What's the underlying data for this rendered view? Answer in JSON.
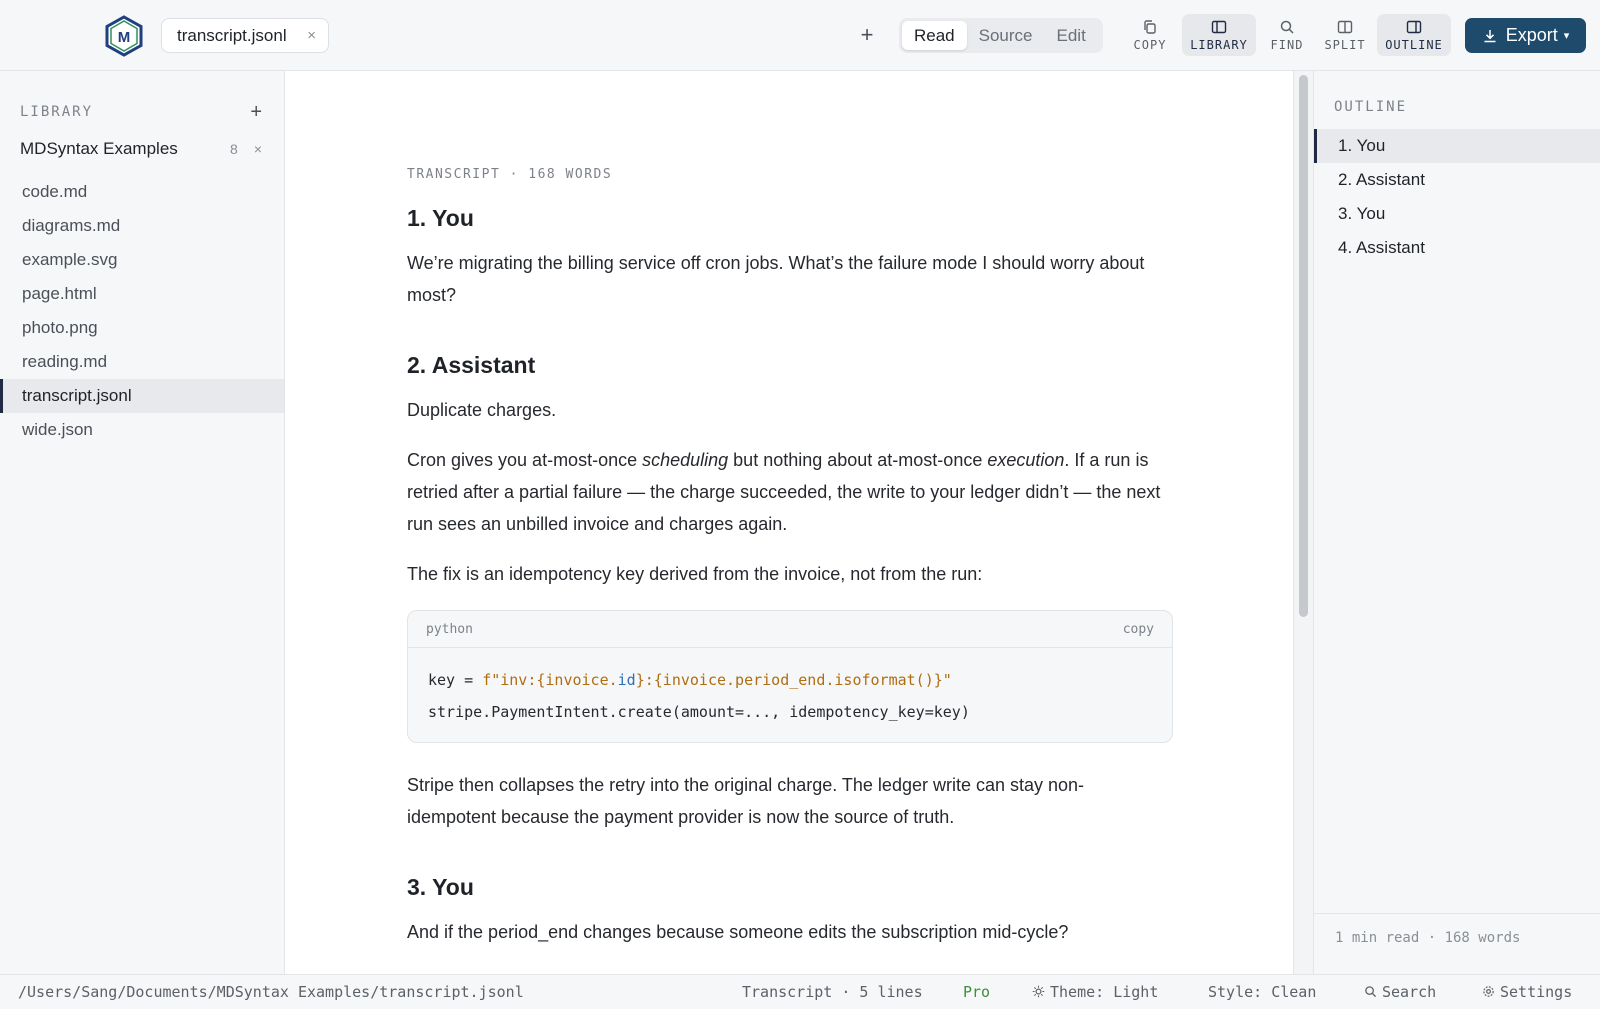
{
  "app": {
    "logo_text": "M"
  },
  "tabs": [
    {
      "label": "transcript.jsonl",
      "close": "×"
    }
  ],
  "toolbar": {
    "new_tab": "+",
    "modes": [
      "Read",
      "Source",
      "Edit"
    ],
    "active_mode": "Read",
    "tools": {
      "copy": "COPY",
      "library": "LIBRARY",
      "find": "FIND",
      "split": "SPLIT",
      "outline": "OUTLINE"
    },
    "export_label": "Export",
    "export_caret": "▾"
  },
  "library": {
    "title": "LIBRARY",
    "add": "+",
    "collection": {
      "name": "MDSyntax Examples",
      "count": "8",
      "close": "×"
    },
    "files": [
      {
        "name": "code.md"
      },
      {
        "name": "diagrams.md"
      },
      {
        "name": "example.svg"
      },
      {
        "name": "page.html"
      },
      {
        "name": "photo.png"
      },
      {
        "name": "reading.md"
      },
      {
        "name": "transcript.jsonl"
      },
      {
        "name": "wide.json"
      }
    ],
    "active_file": "transcript.jsonl"
  },
  "document": {
    "meta": "TRANSCRIPT · 168 WORDS",
    "h1": "1. You",
    "p1": "We’re migrating the billing service off cron jobs. What’s the failure mode I should worry about most?",
    "h2": "2. Assistant",
    "p2": "Duplicate charges.",
    "p3": {
      "a": "Cron gives you at-most-once ",
      "b": "scheduling",
      "c": " but nothing about at-most-once ",
      "d": "execution",
      "e": ". If a run is retried after a partial failure — the charge succeeded, the write to your ledger didn’t — the next run sees an unbilled invoice and charges again."
    },
    "p4": "The fix is an idempotency key derived from the invoice, not from the run:",
    "code": {
      "lang": "python",
      "copy": "copy",
      "line1": {
        "a": "key = ",
        "b": "f\"inv:{invoice.",
        "c": "id",
        "d": "}:{invoice.period_end.isoformat()}\""
      },
      "line2": "stripe.PaymentIntent.create(amount=..., idempotency_key=key)"
    },
    "p5": "Stripe then collapses the retry into the original charge. The ledger write can stay non-idempotent because the payment provider is now the source of truth.",
    "h3": "3. You",
    "p6": "And if the period_end changes because someone edits the subscription mid-cycle?"
  },
  "outline": {
    "title": "OUTLINE",
    "items": [
      {
        "label": "1. You"
      },
      {
        "label": "2. Assistant"
      },
      {
        "label": "3. You"
      },
      {
        "label": "4. Assistant"
      }
    ],
    "active_index": 0,
    "footer": "1 min read · 168 words"
  },
  "status": {
    "path": "/Users/Sang/Documents/MDSyntax Examples/transcript.jsonl",
    "doc_info": "Transcript · 5 lines",
    "plan": "Pro",
    "theme": "Theme: Light",
    "style": "Style: Clean",
    "search": "Search",
    "settings": "Settings"
  },
  "colors": {
    "accent": "#1f2a44",
    "export_button": "#1e4a6b",
    "pro_badge": "#3f8f3a",
    "string_token": "#b06d12",
    "attr_token": "#2f6fb5"
  }
}
